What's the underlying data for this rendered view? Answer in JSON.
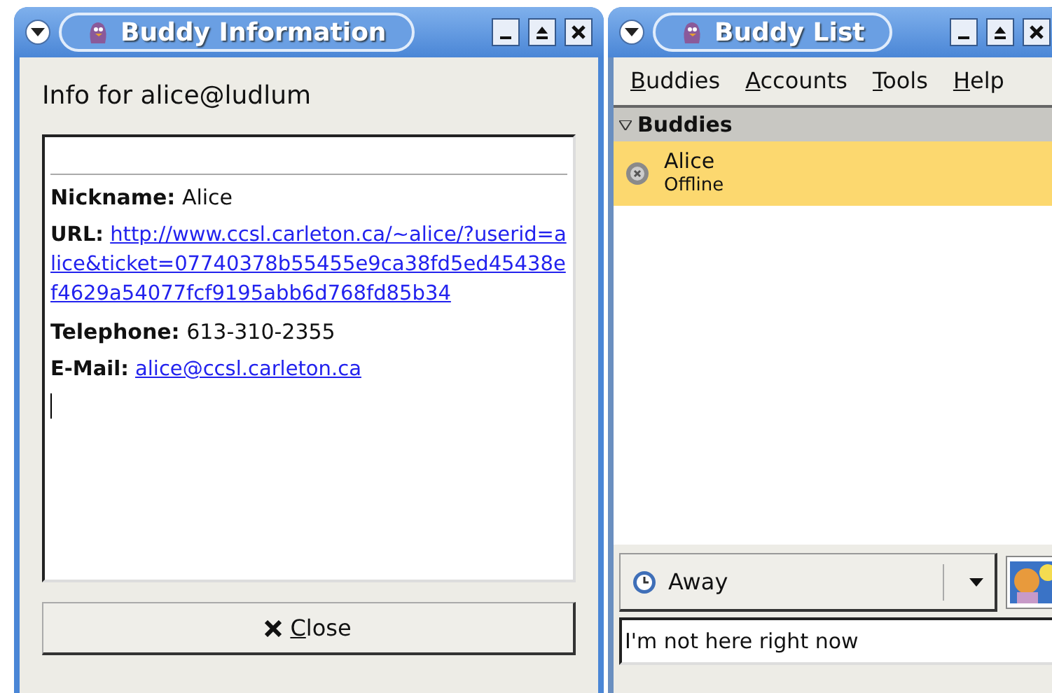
{
  "info_window": {
    "title": "Buddy Information",
    "heading": "Info for alice@ludlum",
    "fields": [
      {
        "label": "Nickname:",
        "value": "Alice",
        "kind": "text"
      },
      {
        "label": "URL:",
        "value": "http://www.ccsl.carleton.ca/~alice/?userid=alice&ticket=07740378b55455e9ca38fd5ed45438ef4629a54077fcf9195abb6d768fd85b34",
        "kind": "link"
      },
      {
        "label": "Telephone:",
        "value": "613-310-2355",
        "kind": "text"
      },
      {
        "label": "E-Mail:",
        "value": "alice@ccsl.carleton.ca",
        "kind": "link"
      }
    ],
    "close_button": "Close"
  },
  "buddy_list_window": {
    "title": "Buddy List",
    "menu": [
      "Buddies",
      "Accounts",
      "Tools",
      "Help"
    ],
    "groups": [
      {
        "name": "Buddies",
        "expanded": true,
        "buddies": [
          {
            "name": "Alice",
            "status": "Offline",
            "selected": true
          }
        ]
      }
    ],
    "status_selector": "Away",
    "status_message": "I'm not here right now"
  }
}
